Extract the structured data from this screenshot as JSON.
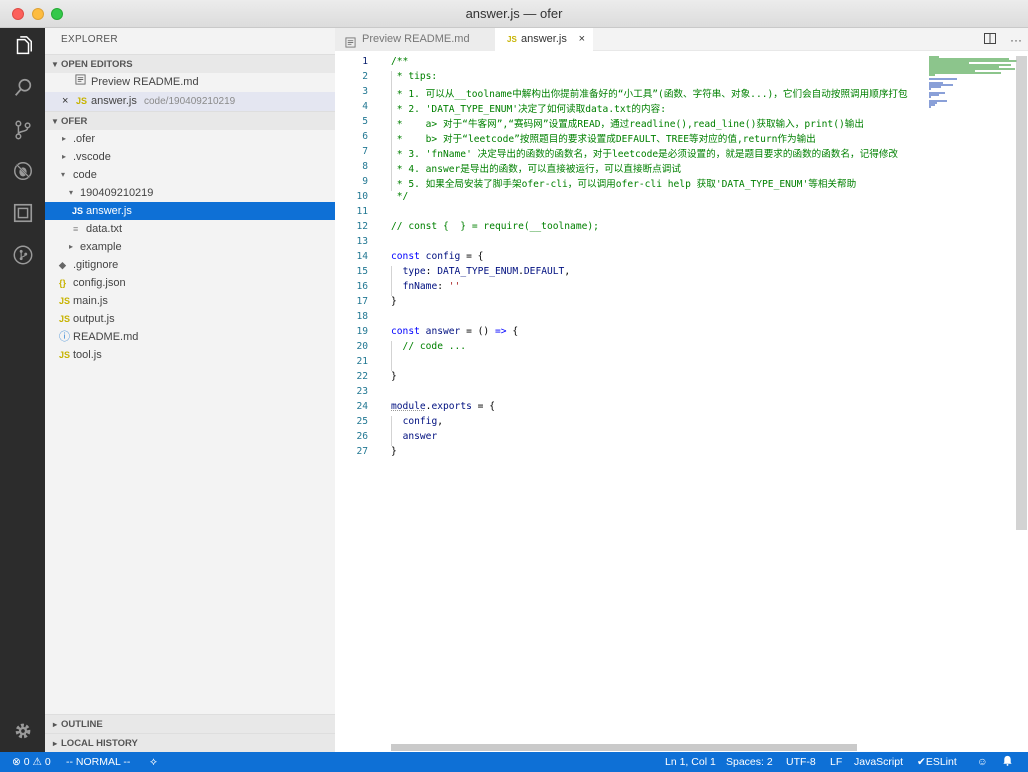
{
  "window": {
    "title": "answer.js — ofer"
  },
  "explorer": {
    "title": "EXPLORER"
  },
  "open_editors": {
    "header": "OPEN EDITORS",
    "items": [
      {
        "label": "Preview README.md",
        "path": ""
      },
      {
        "label": "answer.js",
        "path": "code/190409210219",
        "icon": "JS",
        "close": "×"
      }
    ]
  },
  "project": {
    "header": "OFER",
    "tree": [
      {
        "label": ".ofer",
        "type": "folder"
      },
      {
        "label": ".vscode",
        "type": "folder"
      },
      {
        "label": "code",
        "type": "folder-open"
      },
      {
        "label": "190409210219",
        "type": "folder-open"
      },
      {
        "label": "answer.js",
        "type": "js",
        "icon": "JS"
      },
      {
        "label": "data.txt",
        "type": "txt",
        "icon": "≡"
      },
      {
        "label": "example",
        "type": "folder"
      },
      {
        "label": ".gitignore",
        "type": "git",
        "icon": "◆"
      },
      {
        "label": "config.json",
        "type": "json",
        "icon": "{}"
      },
      {
        "label": "main.js",
        "type": "js",
        "icon": "JS"
      },
      {
        "label": "output.js",
        "type": "js",
        "icon": "JS"
      },
      {
        "label": "README.md",
        "type": "md",
        "icon": "ⓘ"
      },
      {
        "label": "tool.js",
        "type": "js",
        "icon": "JS"
      }
    ]
  },
  "outline": {
    "header": "OUTLINE"
  },
  "local_history": {
    "header": "LOCAL HISTORY"
  },
  "tabs": [
    {
      "label": "Preview README.md",
      "icon": "preview-icon"
    },
    {
      "label": "answer.js",
      "icon": "JS",
      "close": "×"
    }
  ],
  "line_numbers": [
    "1",
    "2",
    "3",
    "4",
    "5",
    "6",
    "7",
    "8",
    "9",
    "10",
    "11",
    "12",
    "13",
    "14",
    "15",
    "16",
    "17",
    "18",
    "19",
    "20",
    "21",
    "22",
    "23",
    "24",
    "25",
    "26",
    "27"
  ],
  "code_lines": [
    "/**",
    " * tips:",
    " * 1. 可以从__toolname中解构出你提前准备好的“小工具”(函数、字符串、对象...)，它们会自动按照调用顺序打包",
    " * 2. 'DATA_TYPE_ENUM'决定了如何读取data.txt的内容:",
    " *    a> 对于“牛客网”,“赛码网”设置成READ，通过readline(),read_line()获取输入，print()输出",
    " *    b> 对于“leetcode”按照题目的要求设置成DEFAULT、TREE等对应的值,return作为输出",
    " * 3. 'fnName' 决定导出的函数的函数名，对于leetcode是必须设置的，就是题目要求的函数的函数名，记得修改",
    " * 4. answer是导出的函数，可以直接被运行，可以直接断点调试",
    " * 5. 如果全局安装了脚手架ofer-cli，可以调用ofer-cli help 获取'DATA_TYPE_ENUM'等相关帮助",
    " */",
    "",
    "// const {  } = require(__toolname);",
    "",
    "const config = {",
    "  type: DATA_TYPE_ENUM.DEFAULT,",
    "  fnName: ''",
    "}",
    "",
    "const answer = () => {",
    "  // code ...",
    "",
    "}",
    "",
    "module.exports = {",
    "  config,",
    "  answer",
    "}"
  ],
  "statusbar": {
    "errors": "0",
    "warnings": "0",
    "mode": "-- NORMAL --",
    "position": "Ln 1, Col 1",
    "spaces": "Spaces: 2",
    "encoding": "UTF-8",
    "eol": "LF",
    "language": "JavaScript",
    "lint": "ESLint"
  },
  "colors": {
    "accent": "#0e70d6",
    "activitybar": "#2c2c2c",
    "comment": "#008000",
    "keyword": "#0000ff"
  }
}
